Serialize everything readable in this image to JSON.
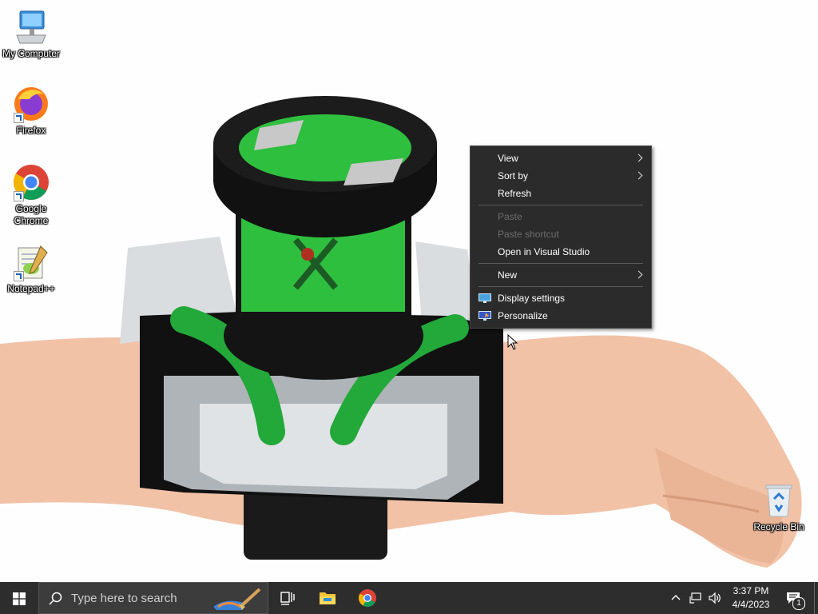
{
  "desktop": {
    "icons": [
      {
        "label": "My Computer",
        "icon": "computer-icon"
      },
      {
        "label": "Firefox",
        "icon": "firefox-icon"
      },
      {
        "label": "Google Chrome",
        "icon": "chrome-icon"
      },
      {
        "label": "Notepad++",
        "icon": "notepad-plus-plus-icon"
      },
      {
        "label": "Recycle Bin",
        "icon": "recycle-bin-icon"
      }
    ]
  },
  "context_menu": {
    "items": [
      {
        "label": "View",
        "submenu": true,
        "enabled": true
      },
      {
        "label": "Sort by",
        "submenu": true,
        "enabled": true
      },
      {
        "label": "Refresh",
        "submenu": false,
        "enabled": true
      },
      {
        "label": "Paste",
        "submenu": false,
        "enabled": false
      },
      {
        "label": "Paste shortcut",
        "submenu": false,
        "enabled": false
      },
      {
        "label": "Open in Visual Studio",
        "submenu": false,
        "enabled": true
      },
      {
        "label": "New",
        "submenu": true,
        "enabled": true
      },
      {
        "label": "Display settings",
        "submenu": false,
        "enabled": true,
        "icon": "display-settings-icon"
      },
      {
        "label": "Personalize",
        "submenu": false,
        "enabled": true,
        "icon": "personalize-icon"
      }
    ]
  },
  "taskbar": {
    "search_placeholder": "Type here to search",
    "pinned": [
      "task-view-icon",
      "file-explorer-icon",
      "chrome-icon"
    ],
    "clock_time": "3:37 PM",
    "clock_date": "4/4/2023",
    "notification_count": "1"
  },
  "colors": {
    "taskbar_bg": "#2d2d2d",
    "menu_bg": "#2b2b2b",
    "watch_green": "#2fbf3f"
  }
}
